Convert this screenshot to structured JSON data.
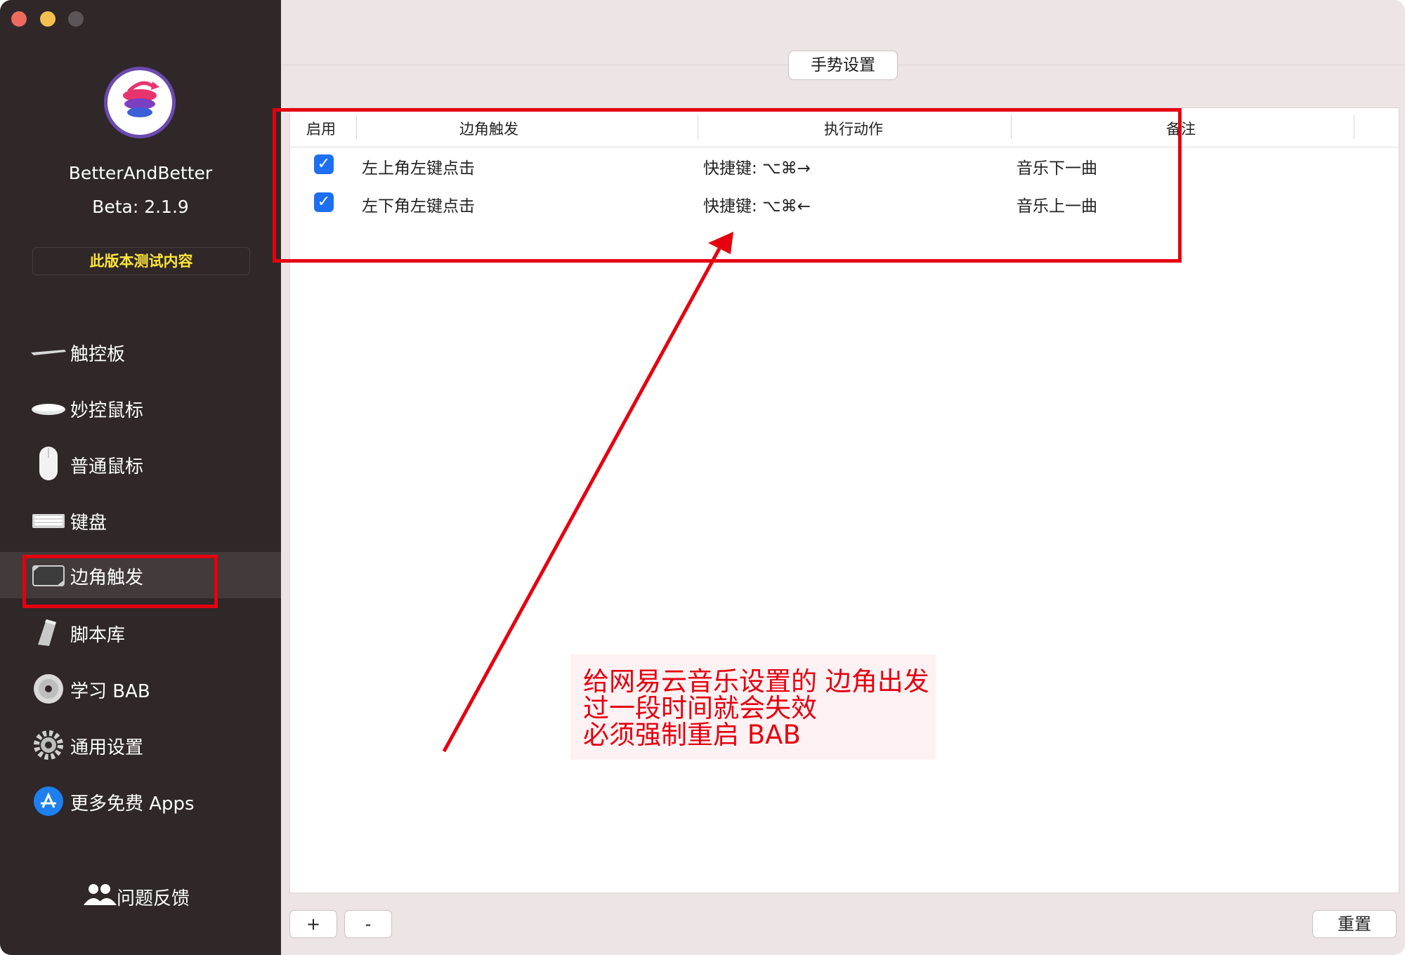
{
  "sidebar": {
    "app_name": "BetterAndBetter",
    "version": "Beta: 2.1.9",
    "beta_button": "此版本测试内容",
    "items": [
      {
        "label": "触控板",
        "icon": "trackpad-icon"
      },
      {
        "label": "妙控鼠标",
        "icon": "magic-mouse-icon"
      },
      {
        "label": "普通鼠标",
        "icon": "mouse-icon"
      },
      {
        "label": "键盘",
        "icon": "keyboard-icon"
      },
      {
        "label": "边角触发",
        "icon": "screen-corner-icon",
        "selected": true
      },
      {
        "label": "脚本库",
        "icon": "script-icon"
      },
      {
        "label": "学习 BAB",
        "icon": "disc-icon"
      },
      {
        "label": "通用设置",
        "icon": "gear-icon"
      },
      {
        "label": "更多免费 Apps",
        "icon": "app-store-icon"
      }
    ],
    "feedback": "问题反馈"
  },
  "main": {
    "tab": "手势设置",
    "table": {
      "headers": [
        "启用",
        "边角触发",
        "执行动作",
        "备注"
      ],
      "rows": [
        {
          "enabled": true,
          "corner": "左上角左键点击",
          "action": "快捷键:  ⌥⌘→",
          "note": "音乐下一曲"
        },
        {
          "enabled": true,
          "corner": "左下角左键点击",
          "action": "快捷键:  ⌥⌘←",
          "note": "音乐上一曲"
        }
      ]
    },
    "add_button": "+",
    "remove_button": "-",
    "reset_button": "重置"
  },
  "annotation": {
    "lines": [
      "给网易云音乐设置的 边角出发",
      "过一段时间就会失效",
      "必须强制重启 BAB"
    ],
    "color": "#e5000f"
  },
  "colors": {
    "sidebar_bg": "#2f2728",
    "accent": "#1e6ff2",
    "beta_text": "#ffe63a"
  }
}
